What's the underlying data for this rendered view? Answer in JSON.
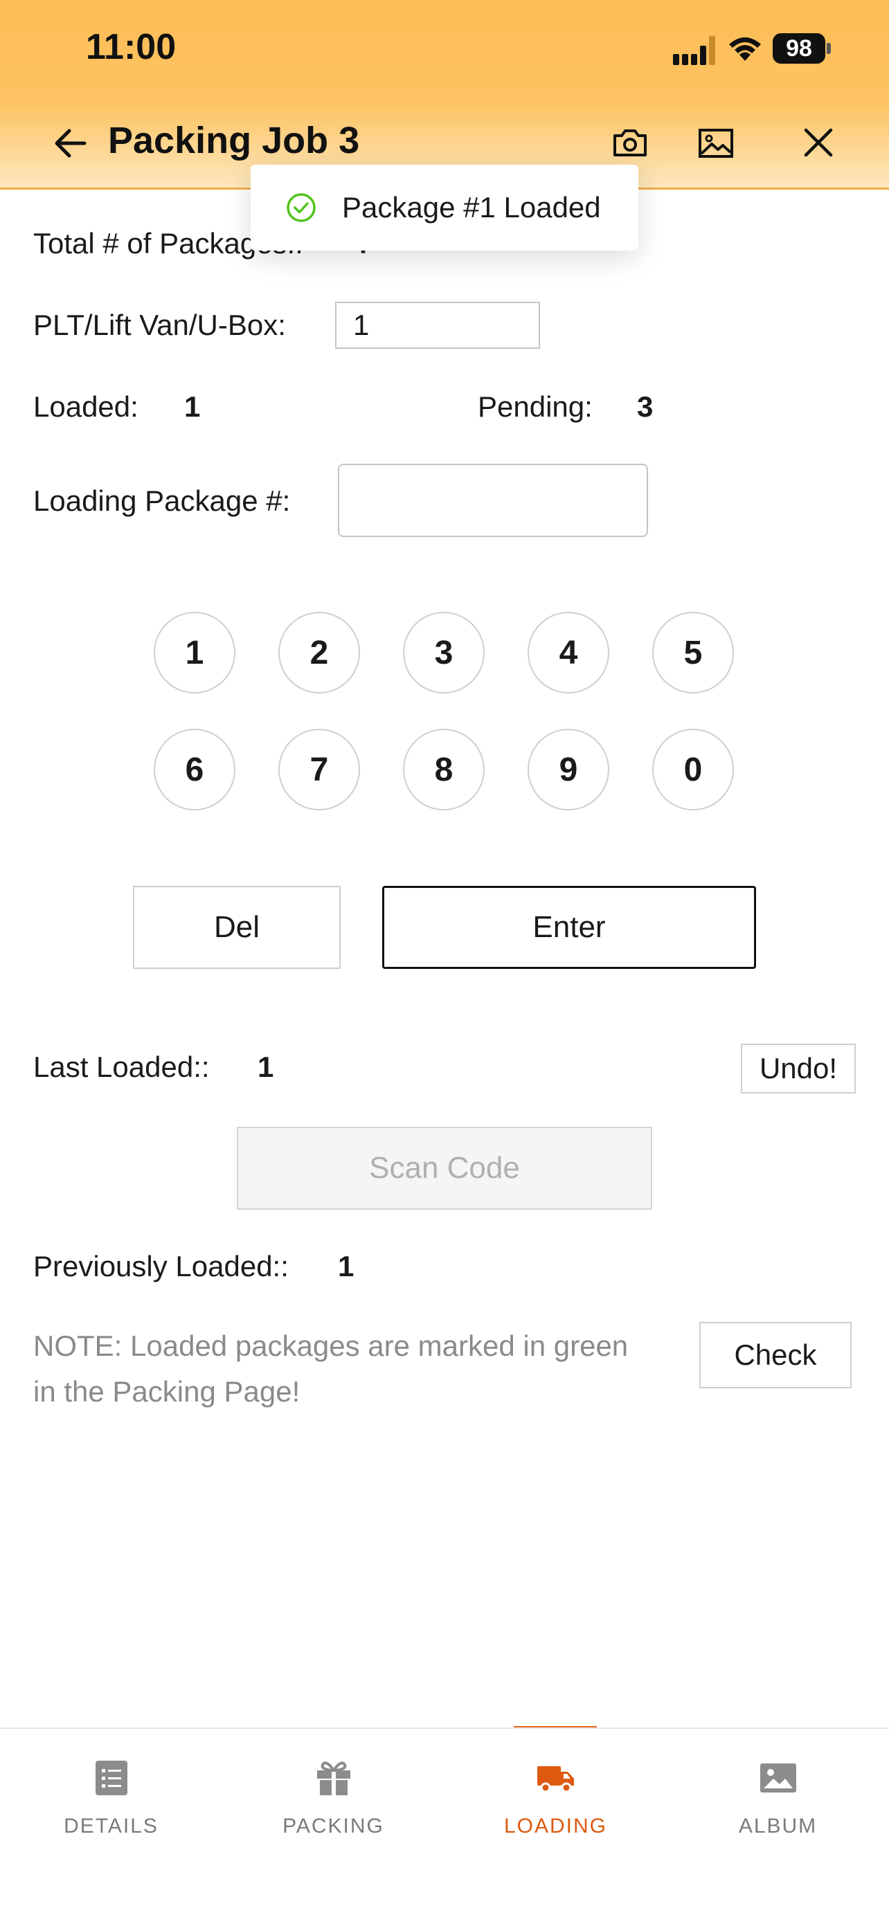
{
  "status_bar": {
    "time": "11:00",
    "battery": "98"
  },
  "header": {
    "title": "Packing Job 3"
  },
  "toast": {
    "message": "Package #1 Loaded"
  },
  "form": {
    "total_label": "Total # of Packages::",
    "total_value": "4",
    "plt_label": "PLT/Lift Van/U-Box:",
    "plt_value": "1",
    "loaded_label": "Loaded:",
    "loaded_value": "1",
    "pending_label": "Pending:",
    "pending_value": "3",
    "loading_pkg_label": "Loading Package #:",
    "loading_pkg_value": ""
  },
  "keypad": {
    "keys": [
      "1",
      "2",
      "3",
      "4",
      "5",
      "6",
      "7",
      "8",
      "9",
      "0"
    ]
  },
  "actions": {
    "del": "Del",
    "enter": "Enter",
    "undo": "Undo!",
    "scan": "Scan Code",
    "check": "Check"
  },
  "last_loaded": {
    "label": "Last Loaded::",
    "value": "1"
  },
  "previously_loaded": {
    "label": "Previously Loaded::",
    "value": "1"
  },
  "note": "NOTE: Loaded packages are marked in green in the Packing Page!",
  "tabs": [
    {
      "label": "DETAILS",
      "icon": "list-icon",
      "active": false
    },
    {
      "label": "PACKING",
      "icon": "gift-icon",
      "active": false
    },
    {
      "label": "LOADING",
      "icon": "truck-icon",
      "active": true
    },
    {
      "label": "ALBUM",
      "icon": "image-icon",
      "active": false
    }
  ],
  "colors": {
    "header_top": "#fdbd55",
    "accent": "#dd5a10",
    "success": "#52c41a"
  }
}
